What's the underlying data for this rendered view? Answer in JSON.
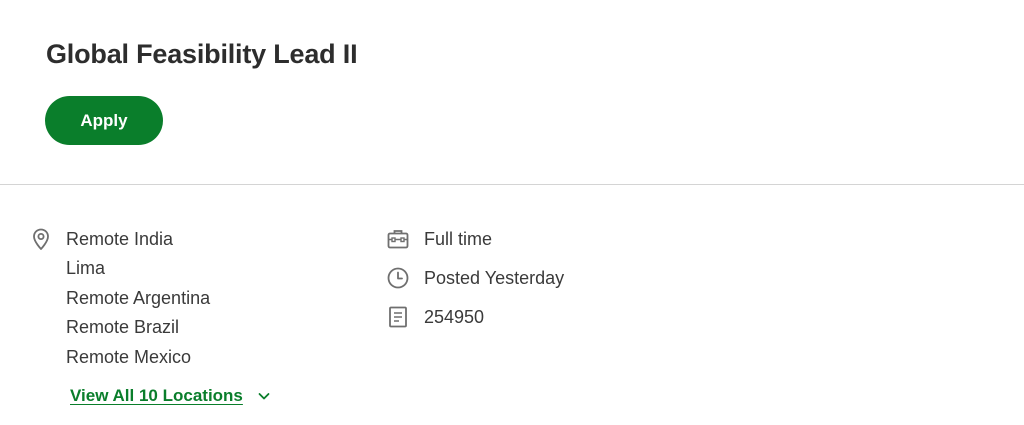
{
  "job": {
    "title": "Global Feasibility Lead II",
    "apply_label": "Apply"
  },
  "details": {
    "locations": [
      "Remote India",
      "Lima",
      "Remote Argentina",
      "Remote Brazil",
      "Remote Mexico"
    ],
    "view_all_label": "View All 10 Locations",
    "job_type": "Full time",
    "posted": "Posted Yesterday",
    "requisition_id": "254950"
  },
  "icons": {
    "location": "location-pin-icon",
    "job_type": "briefcase-icon",
    "posted": "clock-icon",
    "requisition": "document-icon",
    "expand": "chevron-down-icon"
  },
  "colors": {
    "accent": "#0a7e2b",
    "text": "#333333",
    "icon": "#6f6f6f",
    "divider": "#d4d4d4"
  }
}
